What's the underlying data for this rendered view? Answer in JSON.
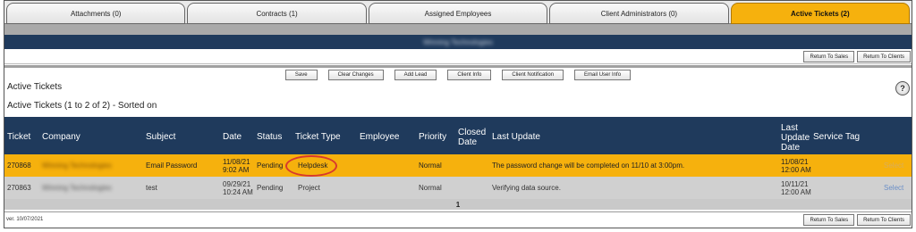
{
  "tabs": [
    {
      "label": "Attachments (0)",
      "active": false
    },
    {
      "label": "Contracts (1)",
      "active": false
    },
    {
      "label": "Assigned Employees",
      "active": false
    },
    {
      "label": "Client Administrators (0)",
      "active": false
    },
    {
      "label": "Active Tickets (2)",
      "active": true
    }
  ],
  "client_name_blurred": "Winning Technologies",
  "nav": {
    "return_sales": "Return To Sales",
    "return_clients": "Return To Clients"
  },
  "actions": {
    "save": "Save",
    "clear": "Clear Changes",
    "add_lead": "Add Lead",
    "client_info": "Client Info",
    "client_notification": "Client Notification",
    "email_user_info": "Email User Info"
  },
  "section_title": "Active Tickets",
  "help": "?",
  "subtitle": "Active Tickets (1 to 2 of 2) - Sorted on",
  "columns": {
    "ticket": "Ticket",
    "company": "Company",
    "subject": "Subject",
    "date": "Date",
    "status": "Status",
    "ticket_type": "Ticket Type",
    "employee": "Employee",
    "priority": "Priority",
    "closed_date": "Closed Date",
    "last_update": "Last Update",
    "last_update_date": "Last Update Date",
    "service_tag": "Service Tag"
  },
  "rows": [
    {
      "ticket": "270868",
      "company": "Winning Technologies",
      "subject": "Email Password",
      "date": "11/08/21",
      "time": "9:02 AM",
      "status": "Pending",
      "ticket_type": "Helpdesk",
      "employee": "",
      "priority": "Normal",
      "closed_date": "",
      "last_update": "The password change will be completed on 11/10 at 3:00pm.",
      "lu_date": "11/08/21",
      "lu_time": "12:00 AM",
      "service_tag": "",
      "select": "Select"
    },
    {
      "ticket": "270863",
      "company": "Winning Technologies",
      "subject": "test",
      "date": "09/29/21",
      "time": "10:24 AM",
      "status": "Pending",
      "ticket_type": "Project",
      "employee": "",
      "priority": "Normal",
      "closed_date": "",
      "last_update": "Verifying data source.",
      "lu_date": "10/11/21",
      "lu_time": "12:00 AM",
      "service_tag": "",
      "select": "Select"
    }
  ],
  "pager": "1",
  "version": "ver. 10/07/2021",
  "colors": {
    "accent": "#f6b10d",
    "header": "#1f3a5c",
    "circle": "#d83a2e"
  }
}
